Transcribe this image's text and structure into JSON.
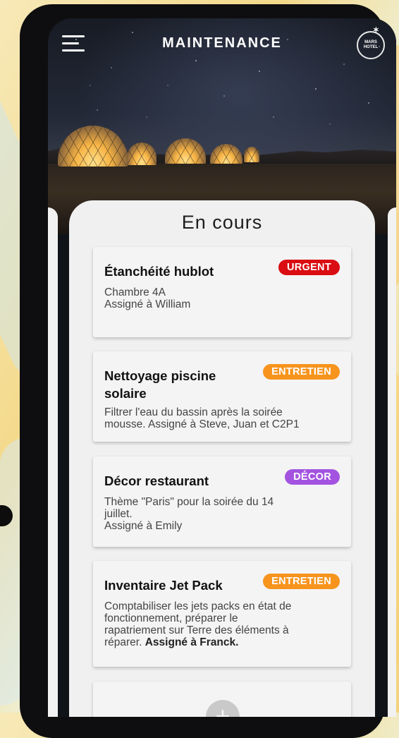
{
  "header": {
    "title": "MAINTENANCE",
    "menu_icon": "hamburger-menu-icon",
    "logo_line1": "MARS",
    "logo_line2": "HOTEL"
  },
  "section_title": "En cours",
  "tasks": [
    {
      "title": "Étanchéité hublot",
      "badge": "URGENT",
      "badge_color": "#d90d12",
      "body_line1": "Chambre 4A",
      "body_line2": "Assigné à William"
    },
    {
      "title_line1": "Nettoyage piscine",
      "title_line2": "solaire",
      "badge": "ENTRETIEN",
      "badge_color": "#f7941d",
      "body_line1": "Filtrer l'eau du bassin après la soirée",
      "body_line2": "mousse. Assigné à Steve, Juan et C2P1"
    },
    {
      "title": "Décor restaurant",
      "badge": "DÉCOR",
      "badge_color": "#a353e0",
      "body_line1": "Thème \"Paris\" pour la soirée du 14",
      "body_line2": "juillet.",
      "body_line3": "Assigné à Emily"
    },
    {
      "title": "Inventaire Jet Pack",
      "badge": "ENTRETIEN",
      "badge_color": "#f7941d",
      "body_line1": "Comptabiliser les jets packs en état de",
      "body_line2": "fonctionnement, préparer le",
      "body_line3": "rapatriement sur Terre des éléments à",
      "body_line4_plain": "réparer.",
      "body_line4_bold": "Assigné à Franck."
    }
  ],
  "add_card": {
    "icon": "plus-icon",
    "label": "+"
  }
}
